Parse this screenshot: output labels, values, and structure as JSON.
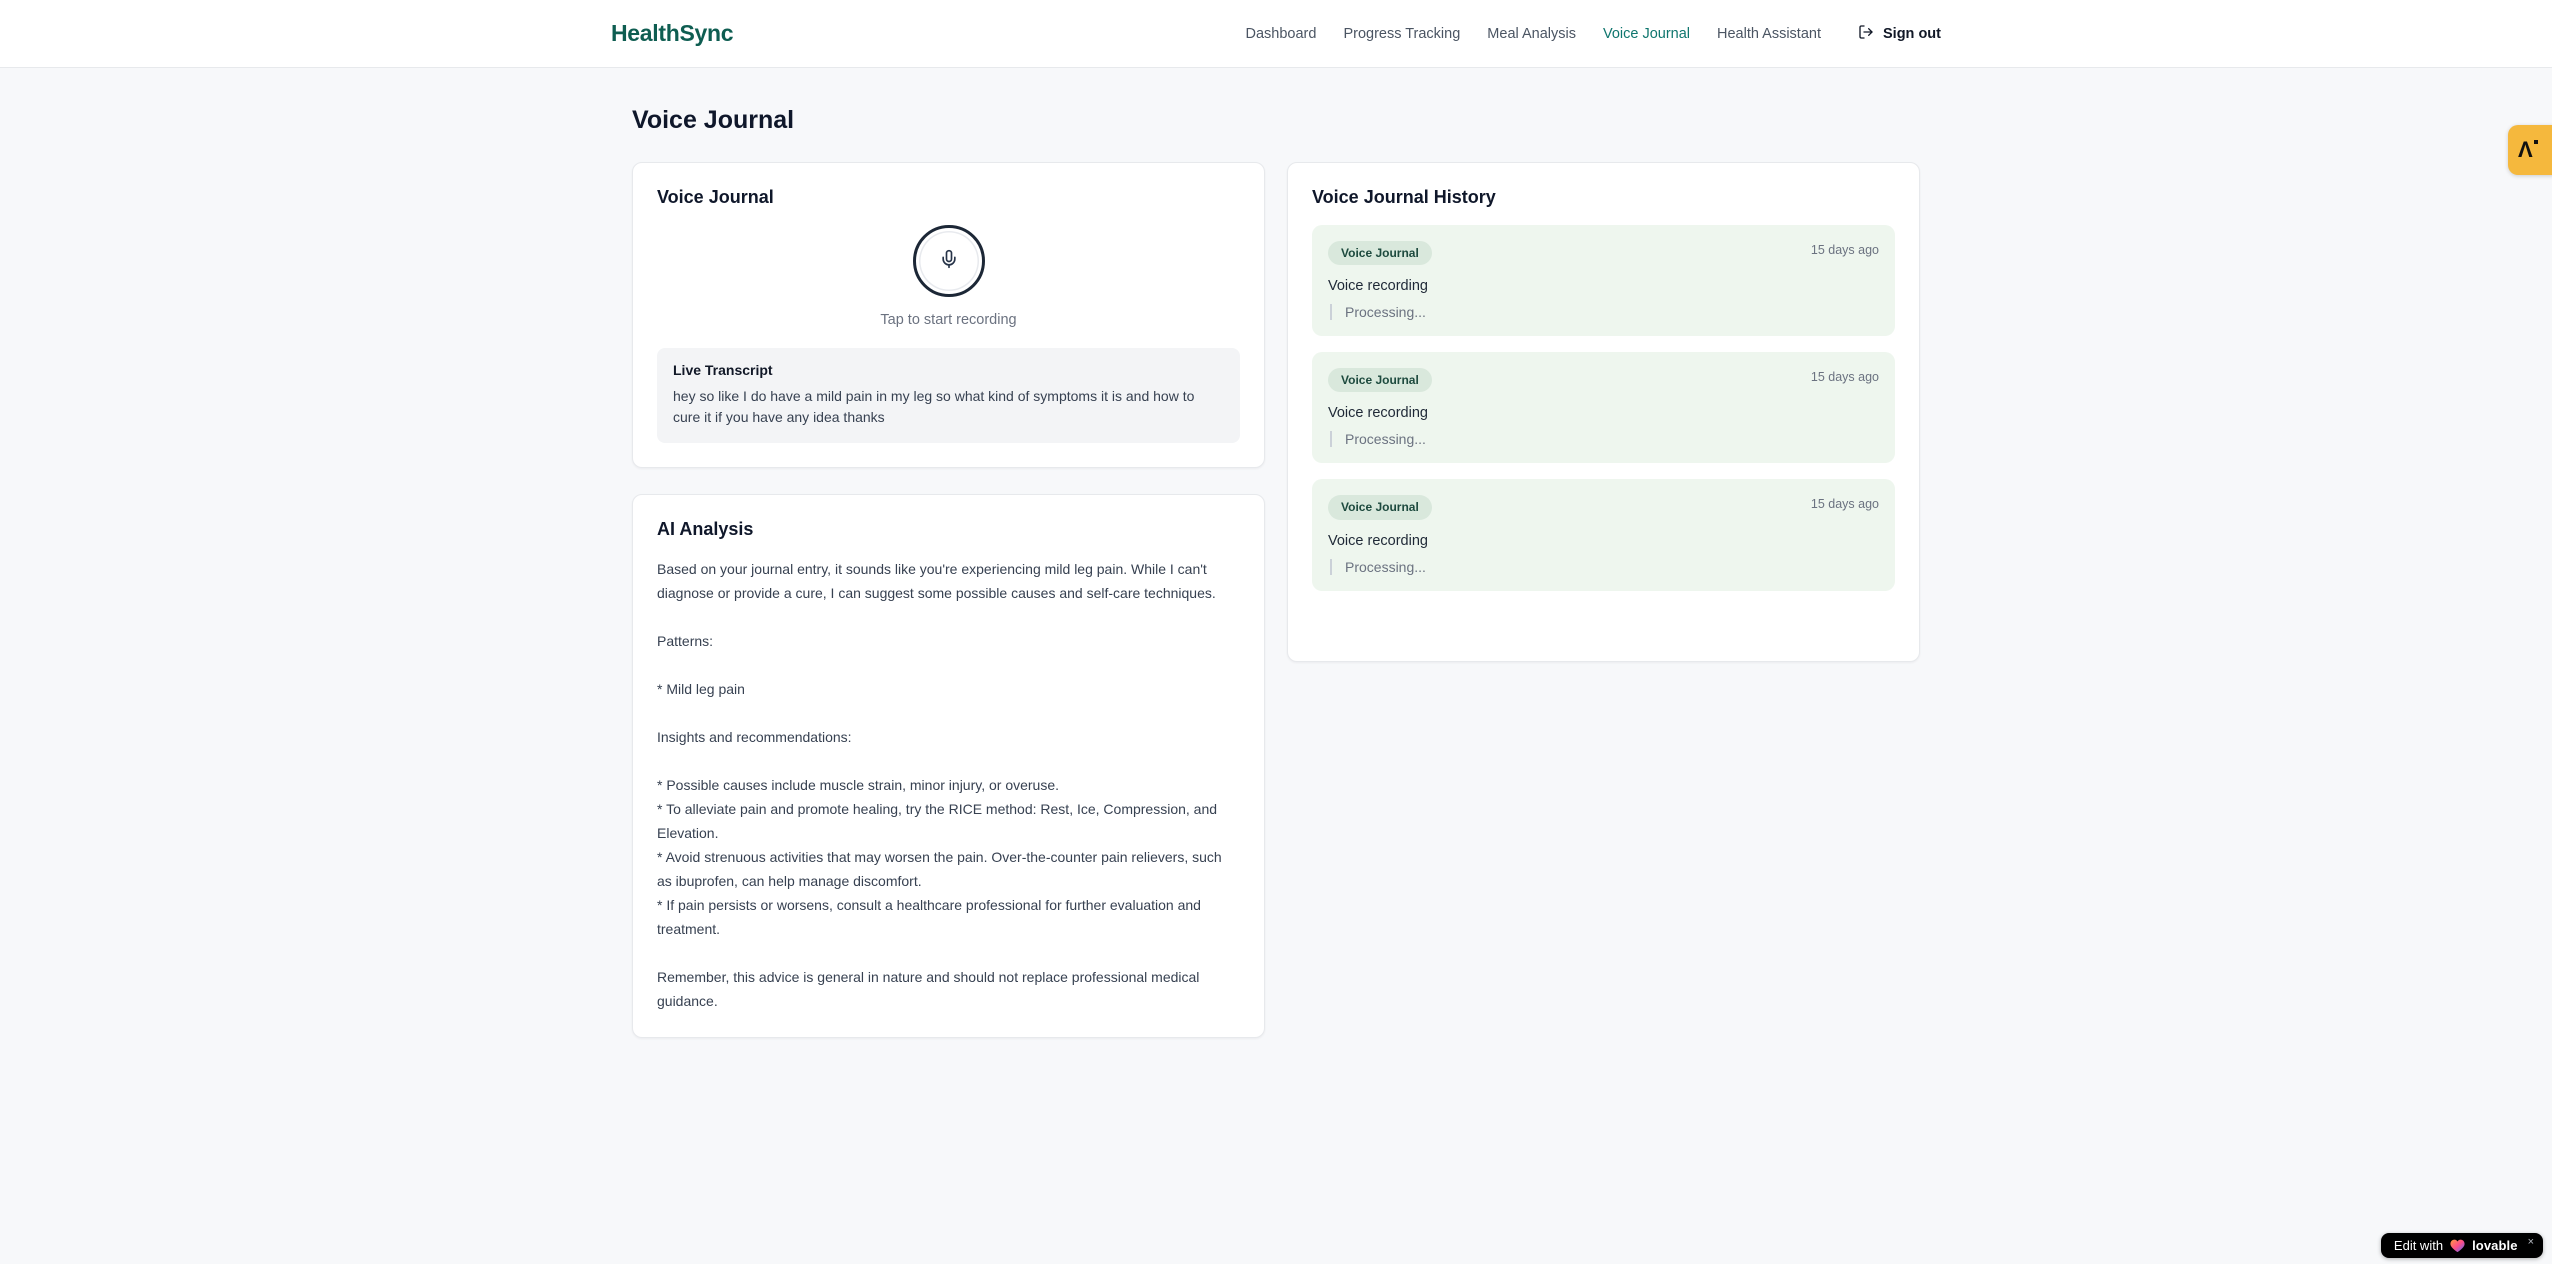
{
  "brand": {
    "name": "HealthSync",
    "color": "#0e5d51"
  },
  "nav": {
    "items": [
      {
        "label": "Dashboard",
        "active": false
      },
      {
        "label": "Progress Tracking",
        "active": false
      },
      {
        "label": "Meal Analysis",
        "active": false
      },
      {
        "label": "Voice Journal",
        "active": true
      },
      {
        "label": "Health Assistant",
        "active": false
      }
    ],
    "sign_out_label": "Sign out"
  },
  "page": {
    "title": "Voice Journal"
  },
  "recorder_card": {
    "title": "Voice Journal",
    "tap_hint": "Tap to start recording",
    "live_transcript_label": "Live Transcript",
    "live_transcript_text": "hey so like I do have a mild pain in my leg so what kind of symptoms it is and how to cure it if you have any idea thanks"
  },
  "analysis_card": {
    "title": "AI Analysis",
    "body": "Based on your journal entry, it sounds like you're experiencing mild leg pain. While I can't diagnose or provide a cure, I can suggest some possible causes and self-care techniques.\n\nPatterns:\n\n* Mild leg pain\n\nInsights and recommendations:\n\n* Possible causes include muscle strain, minor injury, or overuse.\n* To alleviate pain and promote healing, try the RICE method: Rest, Ice, Compression, and Elevation.\n* Avoid strenuous activities that may worsen the pain. Over-the-counter pain relievers, such as ibuprofen, can help manage discomfort.\n* If pain persists or worsens, consult a healthcare professional for further evaluation and treatment.\n\nRemember, this advice is general in nature and should not replace professional medical guidance."
  },
  "history_card": {
    "title": "Voice Journal History",
    "entries": [
      {
        "badge": "Voice Journal",
        "time": "15 days ago",
        "title": "Voice recording",
        "status": "Processing..."
      },
      {
        "badge": "Voice Journal",
        "time": "15 days ago",
        "title": "Voice recording",
        "status": "Processing..."
      },
      {
        "badge": "Voice Journal",
        "time": "15 days ago",
        "title": "Voice recording",
        "status": "Processing..."
      }
    ]
  },
  "lovable_badge": {
    "prefix": "Edit with",
    "brand": "lovable",
    "close": "×"
  },
  "side_badge": {
    "glyph": "Λ"
  },
  "icons": {
    "mic": "mic-icon",
    "logout": "logout-icon",
    "heart": "heart-icon",
    "close": "close-icon"
  },
  "colors": {
    "brand_teal": "#0e5d51",
    "nav_active_teal": "#0f766e",
    "history_entry_bg": "#eef6ee",
    "badge_bg": "#d9e8dc",
    "badge_text": "#1d4a3e",
    "page_bg": "#f7f8fa",
    "accent_orange": "#f5b83d"
  }
}
